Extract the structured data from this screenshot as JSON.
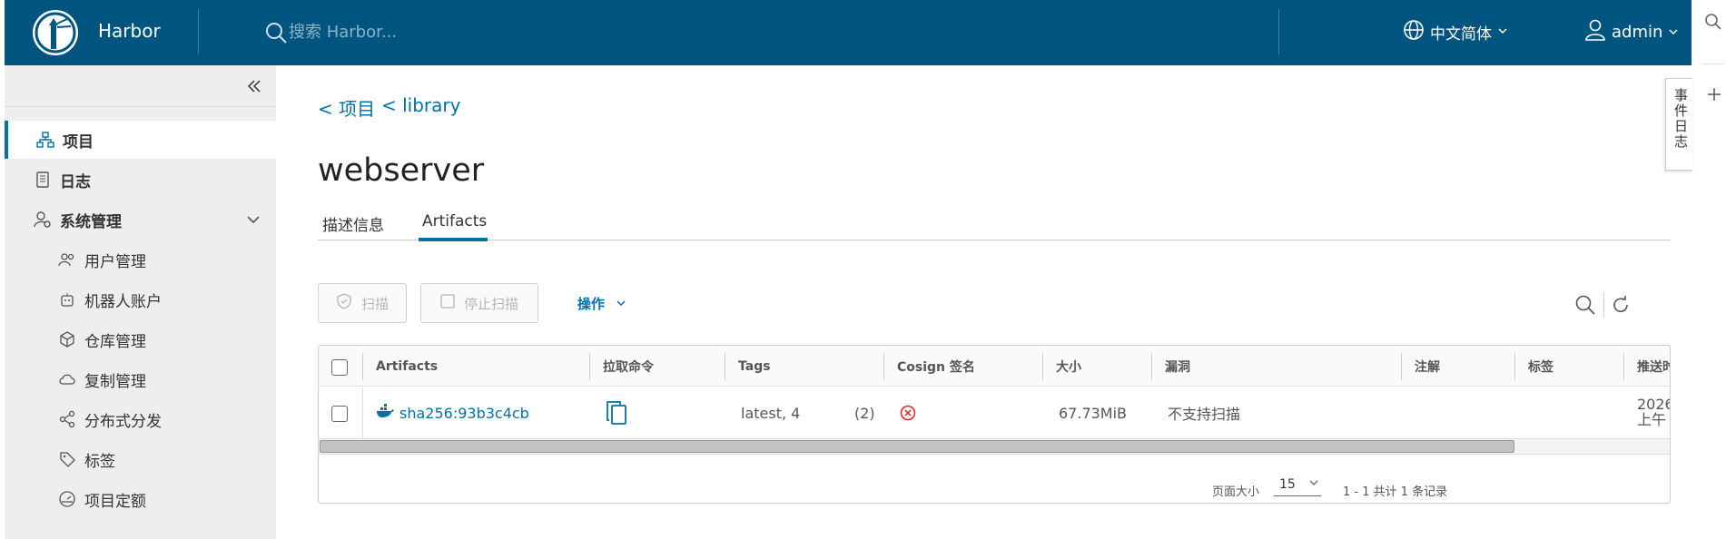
{
  "header": {
    "brand": "Harbor",
    "search_placeholder": "搜索 Harbor...",
    "language": "中文简体",
    "user": "admin"
  },
  "sidebar": {
    "items": [
      {
        "label": "项目",
        "icon": "project-icon",
        "active": true
      },
      {
        "label": "日志",
        "icon": "log-icon"
      },
      {
        "label": "系统管理",
        "icon": "admin-icon",
        "expandable": true
      }
    ],
    "sub_items": [
      {
        "label": "用户管理",
        "icon": "users-icon"
      },
      {
        "label": "机器人账户",
        "icon": "robot-icon"
      },
      {
        "label": "仓库管理",
        "icon": "cube-icon"
      },
      {
        "label": "复制管理",
        "icon": "cloud-sync-icon"
      },
      {
        "label": "分布式分发",
        "icon": "share-icon"
      },
      {
        "label": "标签",
        "icon": "tag-icon"
      },
      {
        "label": "项目定额",
        "icon": "quota-gauge-icon"
      }
    ]
  },
  "breadcrumb": {
    "project": "< 项目",
    "library": "< library"
  },
  "page_title": "webserver",
  "tabs": [
    {
      "label": "描述信息",
      "active": false
    },
    {
      "label": "Artifacts",
      "active": true
    }
  ],
  "toolbar": {
    "scan": "扫描",
    "stop_scan": "停止扫描",
    "actions": "操作"
  },
  "table": {
    "columns": [
      "Artifacts",
      "拉取命令",
      "Tags",
      "Cosign 签名",
      "大小",
      "漏洞",
      "注解",
      "标签",
      "推送时"
    ],
    "rows": [
      {
        "artifact": "sha256:93b3c4cb",
        "tags": "latest, 4",
        "tag_count": "(2)",
        "size": "67.73MiB",
        "vulnerability": "不支持扫描",
        "push_time_line1": "2026",
        "push_time_line2": "上午"
      }
    ],
    "footer": {
      "page_size_label": "页面大小",
      "page_size": "15",
      "summary": "1 - 1 共计 1 条记录"
    }
  },
  "event_log_tab": "事件日志",
  "colors": {
    "header": "#005580",
    "accent": "#0072a3",
    "cosign_error": "#e02020"
  }
}
